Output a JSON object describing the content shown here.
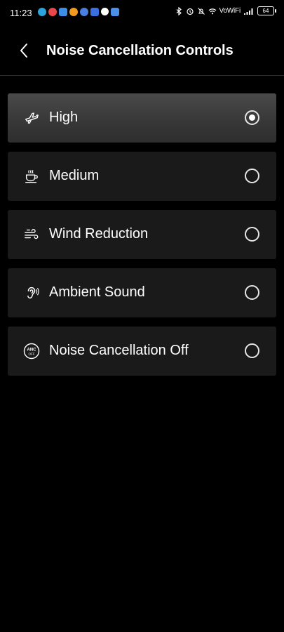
{
  "status_bar": {
    "time": "11:23",
    "notification_icons": [
      {
        "name": "telegram-icon",
        "color": "#2aa3df"
      },
      {
        "name": "heart-app-icon",
        "color": "#e8484a"
      },
      {
        "name": "snowflake-app-icon",
        "color": "#3c8de8"
      },
      {
        "name": "orange-app-icon",
        "color": "#f29a1e"
      },
      {
        "name": "blue-app-icon",
        "color": "#4a7ee0"
      },
      {
        "name": "mail-icon",
        "color": "#3b6fe0"
      },
      {
        "name": "white-dot-icon",
        "color": "#ffffff"
      },
      {
        "name": "blue-app-icon-2",
        "color": "#4a90e8"
      }
    ],
    "network_label": "VoWiFi",
    "battery_level": "64"
  },
  "header": {
    "title": "Noise Cancellation Controls",
    "back_icon": "chevron-left-icon"
  },
  "options": [
    {
      "id": "high",
      "label": "High",
      "icon": "airplane-icon",
      "selected": true
    },
    {
      "id": "medium",
      "label": "Medium",
      "icon": "coffee-cup-icon",
      "selected": false
    },
    {
      "id": "wind",
      "label": "Wind Reduction",
      "icon": "wind-icon",
      "selected": false
    },
    {
      "id": "ambient",
      "label": "Ambient Sound",
      "icon": "ear-icon",
      "selected": false
    },
    {
      "id": "off",
      "label": "Noise Cancellation Off",
      "icon": "anc-off-icon",
      "selected": false
    }
  ],
  "anc_badge": {
    "top": "ANC",
    "bottom": "OFF"
  },
  "colors": {
    "background": "#000000",
    "option_background": "#1a1a1a",
    "selected_background": "#3c3c3c",
    "text": "#ffffff"
  }
}
